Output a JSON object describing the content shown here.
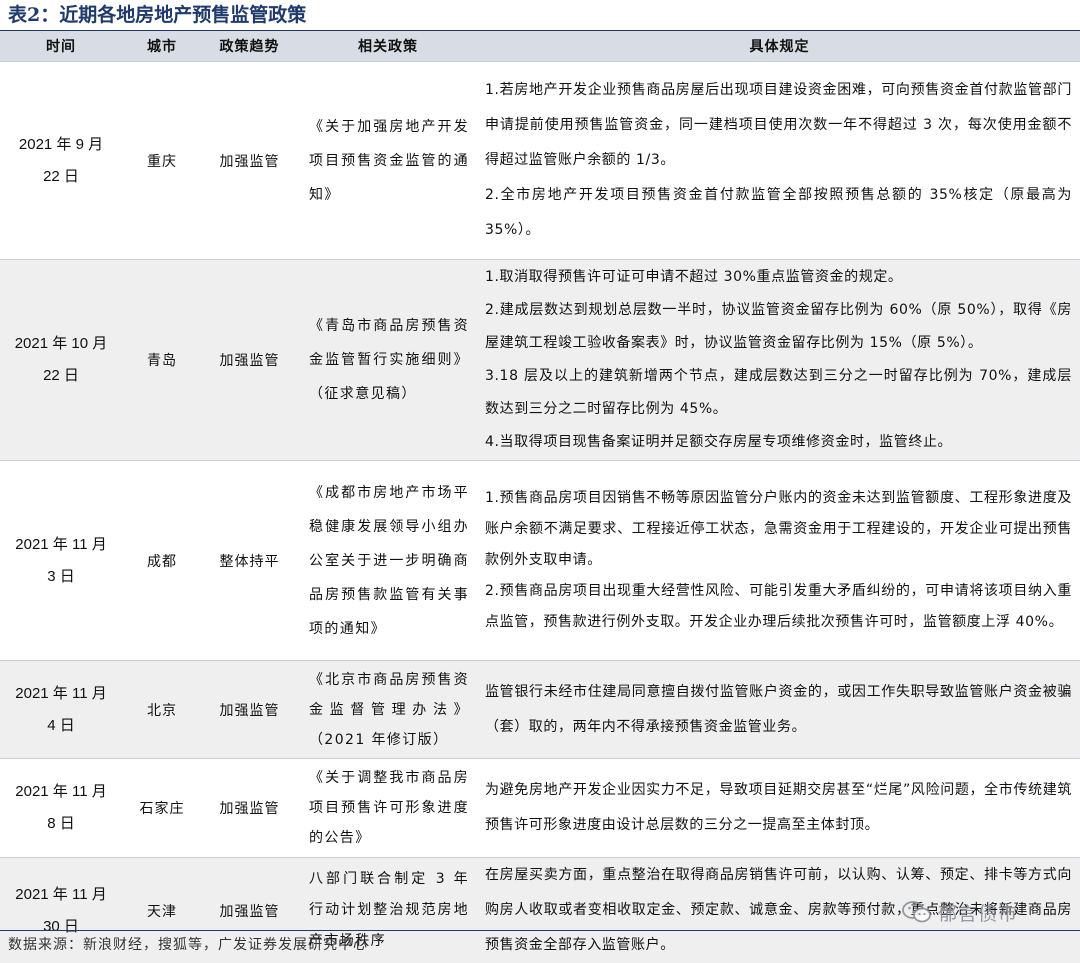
{
  "title": "表2：近期各地房地产预售监管政策",
  "headers": {
    "date": "时间",
    "city": "城市",
    "trend": "政策趋势",
    "policy": "相关政策",
    "detail": "具体规定"
  },
  "rows": [
    {
      "date": "2021 年 9 月 22 日",
      "city": "重庆",
      "trend": "加强监管",
      "policy": "《关于加强房地产开发项目预售资金监管的通知》",
      "details": [
        "1.若房地产开发企业预售商品房屋后出现项目建设资金困难，可向预售资金首付款监管部门申请提前使用预售监管资金，同一建档项目使用次数一年不得超过 3 次，每次使用金额不得超过监管账户余额的 1/3。",
        "2.全市房地产开发项目预售资金首付款监管全部按照预售总额的 35%核定（原最高为 35%）。"
      ]
    },
    {
      "date": "2021 年 10 月 22 日",
      "city": "青岛",
      "trend": "加强监管",
      "policy": "《青岛市商品房预售资金监管暂行实施细则》（征求意见稿）",
      "details": [
        "1.取消取得预售许可证可申请不超过 30%重点监管资金的规定。",
        "2.建成层数达到规划总层数一半时，协议监管资金留存比例为 60%（原 50%），取得《房屋建筑工程竣工验收备案表》时，协议监管资金留存比例为 15%（原 5%）。",
        "3.18 层及以上的建筑新增两个节点，建成层数达到三分之一时留存比例为 70%，建成层数达到三分之二时留存比例为 45%。",
        "4.当取得项目现售备案证明并足额交存房屋专项维修资金时，监管终止。"
      ]
    },
    {
      "date": "2021 年 11 月 3 日",
      "city": "成都",
      "trend": "整体持平",
      "policy": "《成都市房地产市场平稳健康发展领导小组办公室关于进一步明确商品房预售款监管有关事项的通知》",
      "details": [
        "1.预售商品房项目因销售不畅等原因监管分户账内的资金未达到监管额度、工程形象进度及账户余额不满足要求、工程接近停工状态，急需资金用于工程建设的，开发企业可提出预售款例外支取申请。",
        "2.预售商品房项目出现重大经营性风险、可能引发重大矛盾纠纷的，可申请将该项目纳入重点监管，预售款进行例外支取。开发企业办理后续批次预售许可时，监管额度上浮 40%。"
      ]
    },
    {
      "date": "2021 年 11 月 4 日",
      "city": "北京",
      "trend": "加强监管",
      "policy": "《北京市商品房预售资金监督管理办法》（2021 年修订版）",
      "details": [
        "监管银行未经市住建局同意擅自拨付监管账户资金的，或因工作失职导致监管账户资金被骗（套）取的，两年内不得承接预售资金监管业务。"
      ]
    },
    {
      "date": "2021 年 11 月 8 日",
      "city": "石家庄",
      "trend": "加强监管",
      "policy": "《关于调整我市商品房项目预售许可形象进度的公告》",
      "details": [
        "为避免房地产开发企业因实力不足，导致项目延期交房甚至“烂尾”风险问题，全市传统建筑预售许可形象进度由设计总层数的三分之一提高至主体封顶。"
      ]
    },
    {
      "date": "2021 年 11 月 30 日",
      "city": "天津",
      "trend": "加强监管",
      "policy": "八部门联合制定 3 年行动计划整治规范房地产市场秩序",
      "details": [
        "在房屋买卖方面，重点整治在取得商品房销售许可前，以认购、认筹、预定、排卡等方式向购房人收取或者变相收取定金、预定款、诚意金、房款等预付款，重点整治未将新建商品房预售资金全部存入监管账户。"
      ]
    }
  ],
  "source": "数据来源：新浪财经，搜狐等，广发证券发展研究中心",
  "watermark": "郁言债市"
}
